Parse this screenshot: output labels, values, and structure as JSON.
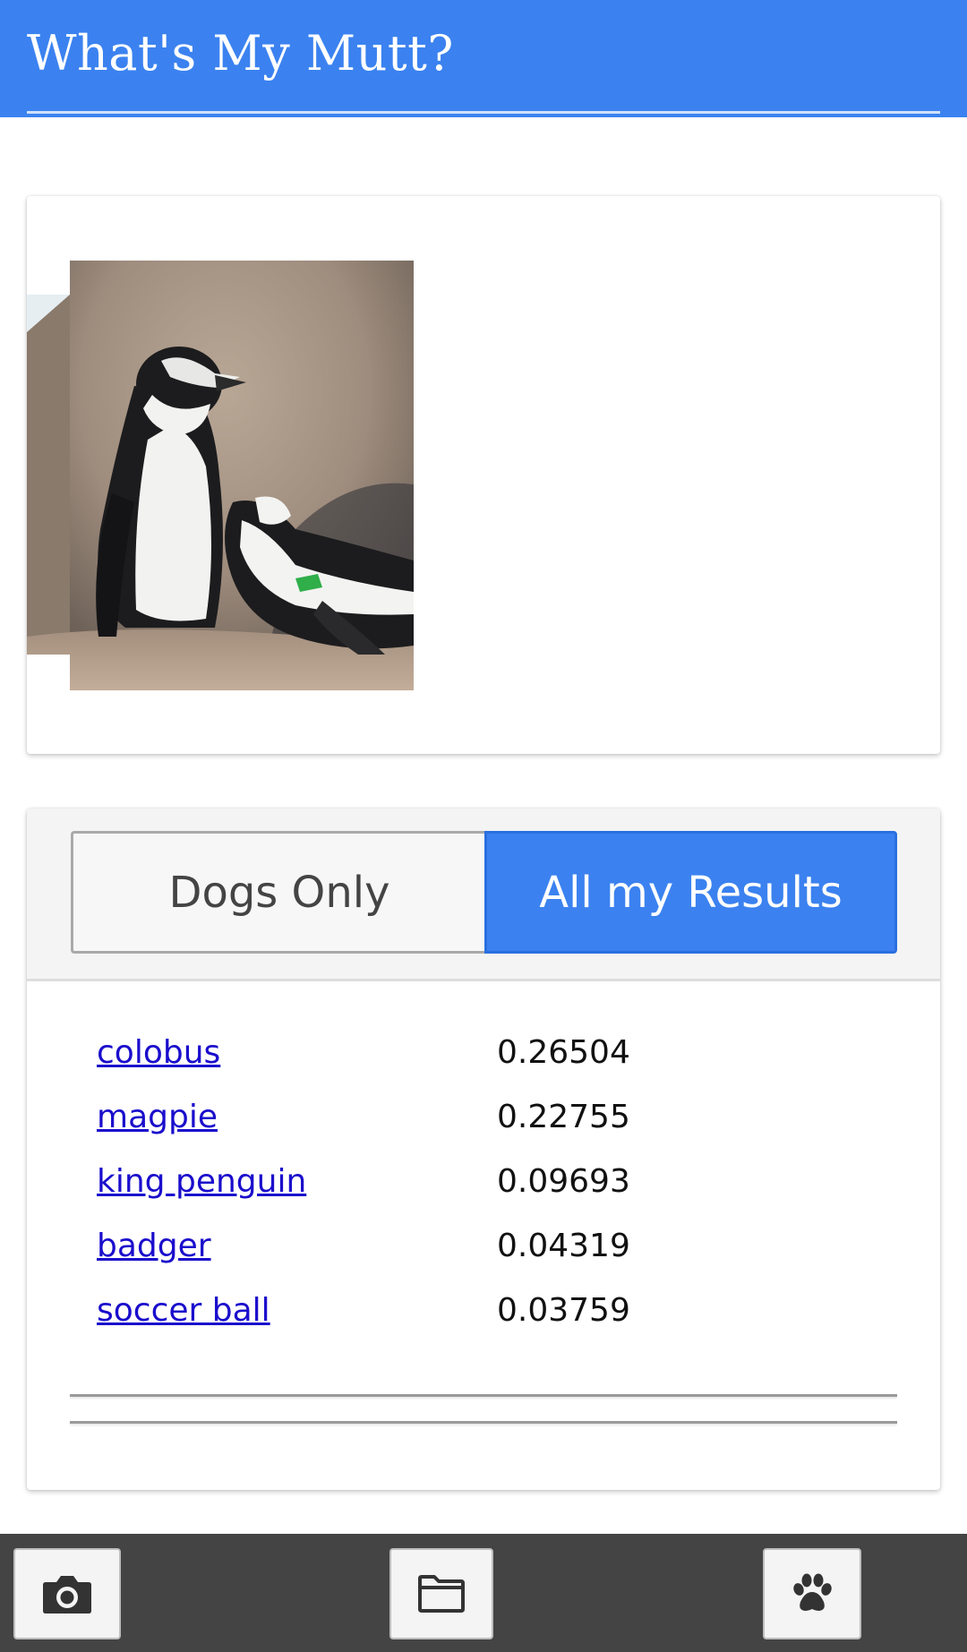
{
  "header": {
    "title": "What's My Mutt?"
  },
  "image_card": {
    "photo_icon": "penguins-photo"
  },
  "tabs": {
    "dogs_only": "Dogs Only",
    "all_results": "All my Results",
    "active": "all_results"
  },
  "results": [
    {
      "label": "colobus",
      "score": "0.26504"
    },
    {
      "label": "magpie",
      "score": "0.22755"
    },
    {
      "label": "king penguin",
      "score": "0.09693"
    },
    {
      "label": "badger",
      "score": "0.04319"
    },
    {
      "label": "soccer ball",
      "score": "0.03759"
    }
  ],
  "bottom_bar": {
    "buttons": [
      "camera-icon",
      "folder-icon",
      "paw-icon"
    ]
  },
  "colors": {
    "accent": "#3b82f0",
    "link": "#1a0dcc",
    "bottom_bar": "#444444"
  }
}
